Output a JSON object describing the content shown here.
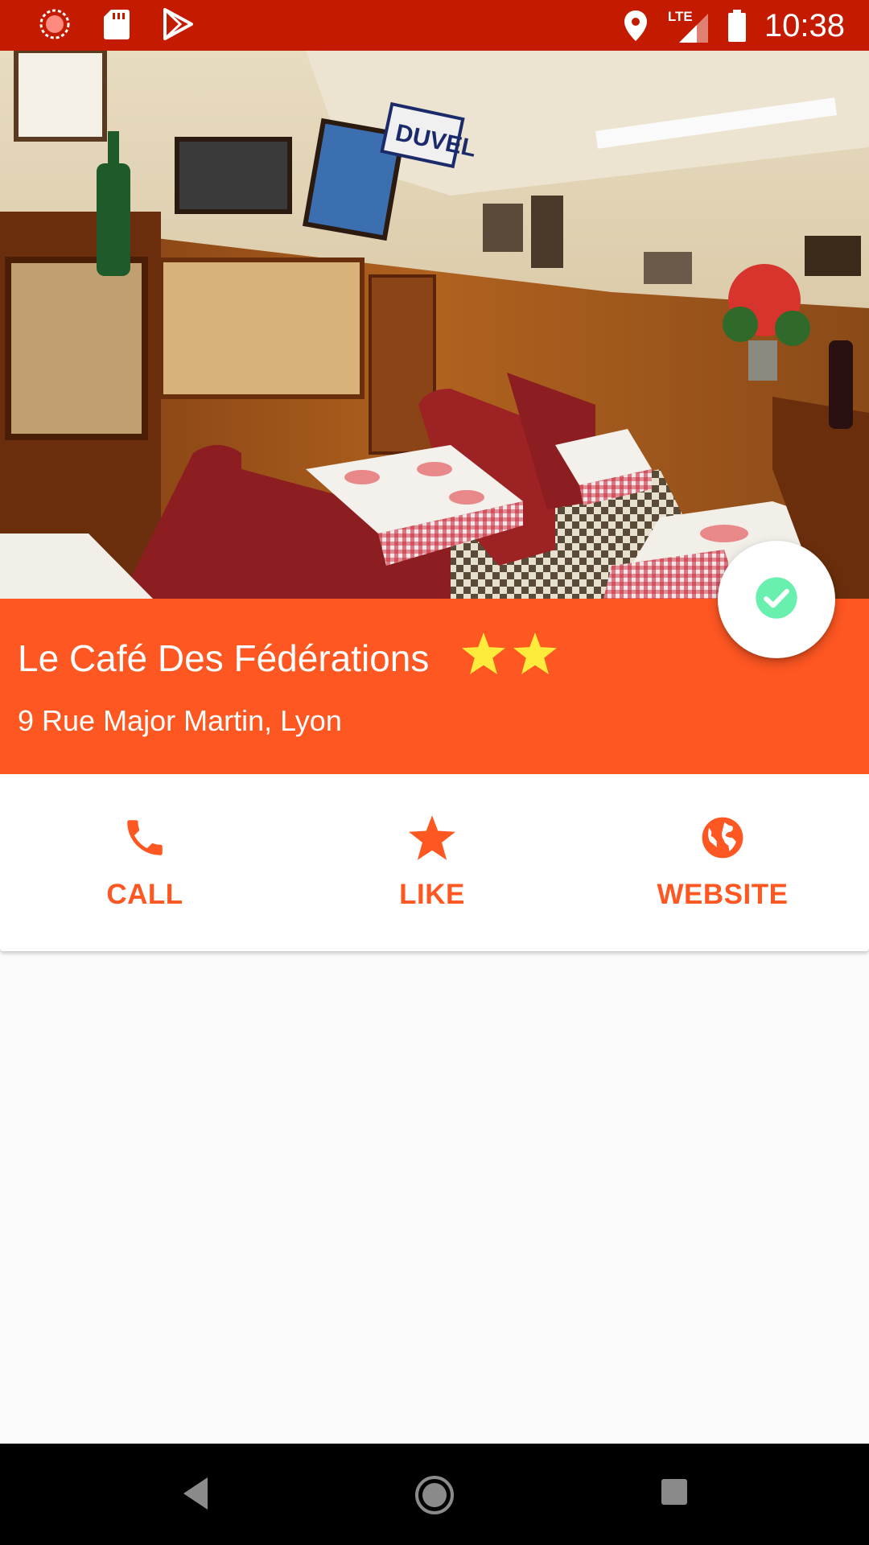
{
  "status_bar": {
    "time": "10:38",
    "network_label": "LTE",
    "icons": [
      "notification-icon",
      "sd-card-icon",
      "play-store-icon",
      "location-icon",
      "signal-icon",
      "battery-icon"
    ]
  },
  "hero": {
    "image_text": "DUVEL"
  },
  "place": {
    "name": "Le Café Des Fédérations",
    "address": "9 Rue Major Martin, Lyon",
    "rating_stars": 2
  },
  "actions": [
    {
      "label": "CALL",
      "icon": "phone-icon"
    },
    {
      "label": "LIKE",
      "icon": "star-icon"
    },
    {
      "label": "WEBSITE",
      "icon": "globe-icon"
    }
  ],
  "fab": {
    "icon": "check-circle-icon"
  },
  "colors": {
    "status_bar": "#c41a00",
    "accent": "#ff5722",
    "star": "#ffeb3b",
    "check": "#69f0ae"
  },
  "nav": {
    "icons": [
      "back-icon",
      "home-icon",
      "recents-icon"
    ]
  }
}
